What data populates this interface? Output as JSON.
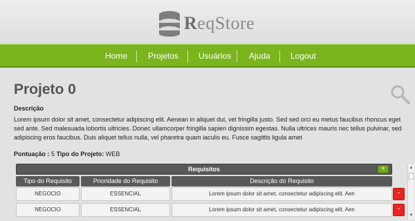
{
  "app": {
    "logo_text_bold": "R",
    "logo_text_rest": "eqStore"
  },
  "nav": {
    "items": [
      "Home",
      "Projetos",
      "Usuários",
      "Ajuda",
      "Logout"
    ]
  },
  "project": {
    "title": "Projeto 0",
    "description_label": "Descrição",
    "description": "Lorem ipsum dolor sit amet, consectetur adipiscing elit. Aenean in aliquet dui, vel fringilla justo. Sed sed orci eu metus faucibus rhoncus eget sed ante. Sed malesuada lobortis ultricies. Donec ullamcorper fringilla sapien dignissim egestas. Nulla ultrices mauris nec tellus pulvinar, sed adipiscing eros faucibus. Duis aliquet tellus nulla, vel pharetra quam iaculis eu. Fusce sagittis ligula amet",
    "score_label": "Pontuação :",
    "score_value": "5",
    "type_label": "Tipo do Projeto:",
    "type_value": "WEB"
  },
  "requirements": {
    "title": "Requisitos",
    "add_label": "+",
    "delete_label": "-",
    "columns": [
      "Tipo do Requisito",
      "Prioridade do Requisito",
      "Descrição do Requisito"
    ],
    "rows": [
      [
        "NEGOCIO",
        "ESSENCIAL",
        "Lorem ipsum dolor sit amet, consectetur adipiscing elit. Aen"
      ],
      [
        "NEGOCIO",
        "ESSENCIAL",
        "Lorem ipsum dolor sit amet, consectetur adipiscing elit. Aen"
      ]
    ]
  },
  "colors": {
    "nav_green": "#7bb51e",
    "delete_red": "#e8251e",
    "header_dark": "#585858"
  },
  "icons": {
    "logo": "database-icon",
    "search": "magnifier-icon",
    "scroll_up": "scroll-up-icon",
    "scroll_down": "scroll-down-icon"
  },
  "scroll": {
    "up": "▲",
    "down": "▼"
  }
}
